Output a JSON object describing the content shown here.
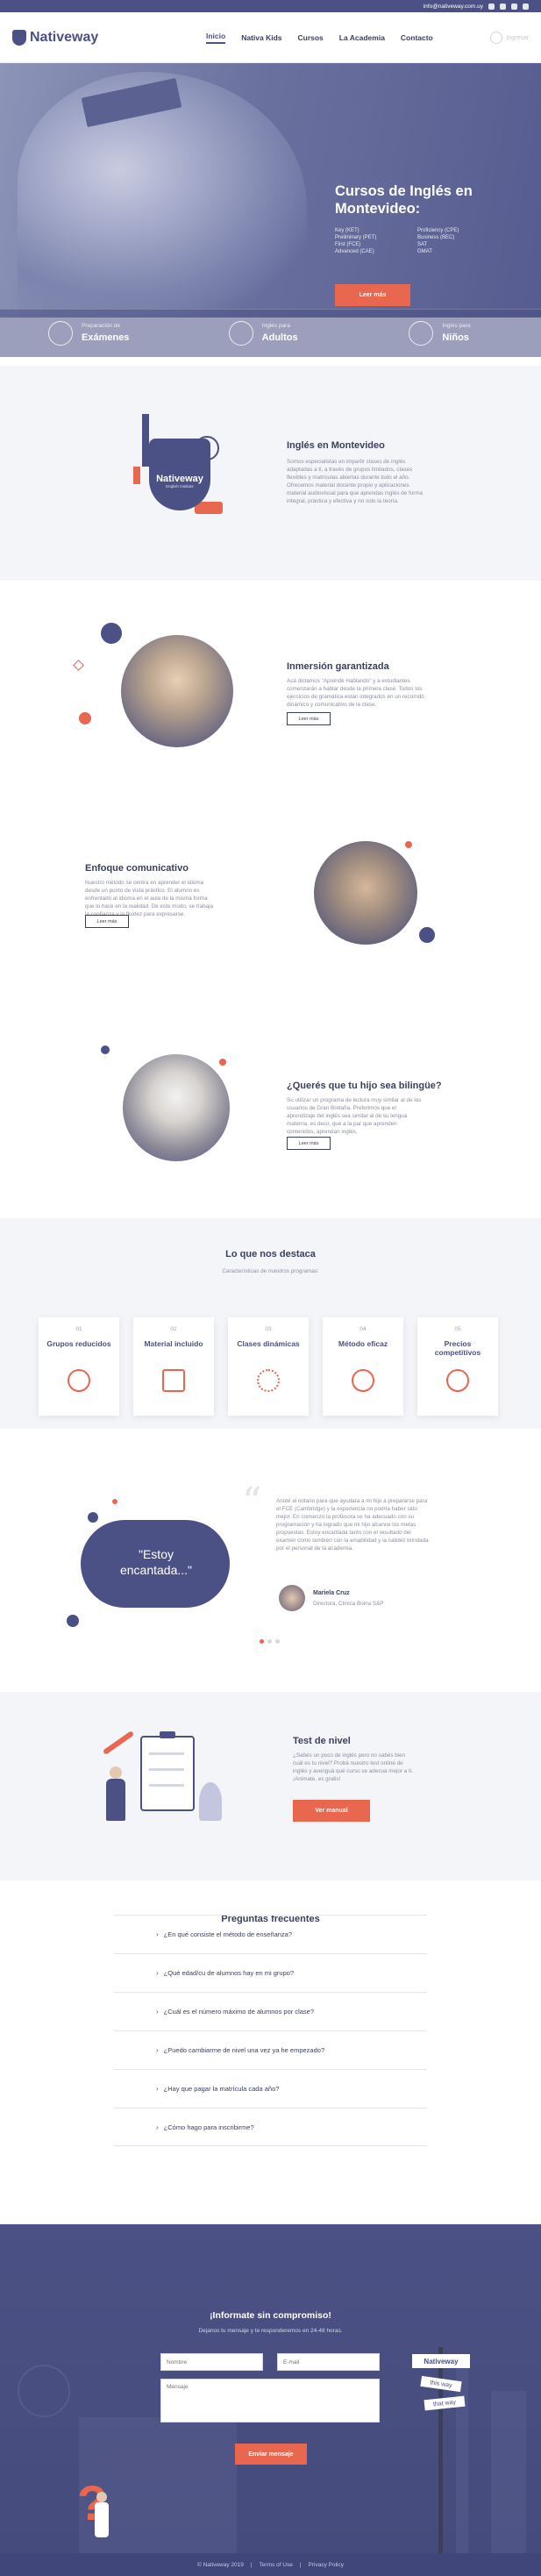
{
  "topbar": {
    "email": "info@nativeway.com.uy"
  },
  "header": {
    "logo_text": "Nativeway",
    "nav": [
      "Inicio",
      "Nativa Kids",
      "Cursos",
      "La Academia",
      "Contacto"
    ],
    "login_label": "Ingresar"
  },
  "hero": {
    "title": "Cursos de Inglés en Montevideo:",
    "exams": [
      "Key (KET)",
      "Proficiency (CPE)",
      "Preliminary (PET)",
      "Business (BEC)",
      "First (FCE)",
      "SAT",
      "Advanced (CAE)",
      "GMAT"
    ],
    "button": "Leer más"
  },
  "features": [
    {
      "small": "Preparación de",
      "big": "Exámenes",
      "icon": "graduation-cap-icon"
    },
    {
      "small": "Inglés para",
      "big": "Adultos",
      "icon": "location-icon"
    },
    {
      "small": "Inglés para",
      "big": "Niños",
      "icon": "child-icon"
    }
  ],
  "intro": {
    "title": "Inglés en Montevideo",
    "text": "Somos especialistas en impartir clases de inglés adaptadas a ti, a través de grupos limitados, clases flexibles y matrículas abiertas durante todo el año. Ofrecemos material docente propio y aplicaciones material audiovisual para que aprendas inglés de forma integral, práctica y efectiva y no solo la teoría.",
    "crest_text": "Nativeway",
    "crest_sub": "English Institute"
  },
  "immersion": {
    "title": "Inmersión garantizada",
    "text": "Acá dictamos \"Aprendé Hablando\" y a estudiantes comenzarán a hablar desde la primera clase. Todos los ejercicios de gramática están integrados en un recorrido dinámico y comunicativo de la clase.",
    "button": "Leer más"
  },
  "communicative": {
    "title": "Enfoque comunicativo",
    "text": "Nuestro método se centra en aprender el idioma desde un punto de vista práctico. El alumno es enfrentado al idioma en el aula de la misma forma que lo hace en la realidad. De este modo, se trabaja la confianza y la fluidez para expresarse.",
    "button": "Leer más"
  },
  "bilingual": {
    "title": "¿Querés que tu hijo sea bilingüe?",
    "text": "Su utilizar un programa de lectura muy similar al de los usuarios de Gran Bretaña. Preferimos que el aprendizaje del inglés sea similar al de su lengua materna, es decir, que a la par que aprenden contenidos, aprendan inglés.",
    "button": "Leer más"
  },
  "highlights": {
    "title": "Lo que nos destaca",
    "subtitle": "Características de nuestros programas:",
    "cards": [
      {
        "num": "01",
        "title": "Grupos reducidos",
        "icon": "group-icon"
      },
      {
        "num": "02",
        "title": "Material incluido",
        "icon": "books-icon"
      },
      {
        "num": "03",
        "title": "Clases dinámicas",
        "icon": "sparkle-icon"
      },
      {
        "num": "04",
        "title": "Método eficaz",
        "icon": "target-icon"
      },
      {
        "num": "05",
        "title": "Precios competitivos",
        "icon": "money-icon"
      }
    ]
  },
  "testimonial": {
    "quote": "\"Estoy encantada...\"",
    "text": "Anoté al notario para que ayudara a mi hijo a prepararse para el FCE (Cambridge) y la experiencia no podría haber sido mejor. En comienzo la profesora se ha adecuado con su programación y ha logrado que mi hijo alcance los metas propuestas. Estoy encantada tanto con el resultado del examen como también con la amabilidad y la calidez brindada por el personal de la academia.",
    "name": "Mariela Cruz",
    "role": "Directora, Clínica Boina S&P"
  },
  "level_test": {
    "title": "Test de nivel",
    "text": "¿Sabés un poco de inglés pero no sabés bien cuál es tu nivel? Probá nuestro test online de inglés y averiguá qué curso se adecua mejor a ti. ¡Animate, es gratis!",
    "button": "Ver manual"
  },
  "faq": {
    "title": "Preguntas frecuentes",
    "items": [
      "¿En qué consiste el método de enseñanza?",
      "¿Qué edad/cu de alumnos hay en mi grupo?",
      "¿Cuál es el número máximo de alumnos por clase?",
      "¿Puedo cambiarme de nivel una vez ya he empezado?",
      "¿Hay que pagar la matrícula cada año?",
      "¿Cómo hago para inscribirme?"
    ]
  },
  "contact": {
    "title": "¡Informate sin compromiso!",
    "subtitle": "Dejanos tu mensaje y te responderemos en 24-48 horas.",
    "name_placeholder": "Nombre",
    "email_placeholder": "E-mail",
    "message_placeholder": "Mensaje",
    "button": "Enviar mensaje",
    "signs": [
      "Nativeway",
      "this way",
      "that way"
    ]
  },
  "footer": {
    "copyright": "© Nativeway 2019",
    "terms": "Terms of Use",
    "privacy": "Privacy Policy"
  },
  "colors": {
    "primary": "#4b5184",
    "accent": "#e9664f",
    "light": "#f4f5f9"
  }
}
